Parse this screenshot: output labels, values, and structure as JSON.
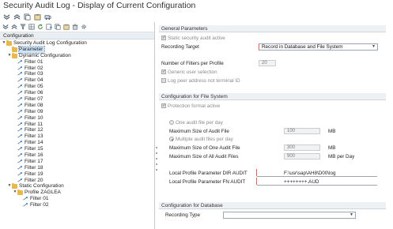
{
  "window": {
    "title": "Security Audit Log - Display of Current Configuration"
  },
  "toolbar_icons": [
    "expand-all-icon",
    "collapse-all-icon",
    "copy-icon",
    "paste-icon",
    "transport-icon"
  ],
  "tree_toolbar_icons": [
    "expand-all-icon",
    "collapse-all-icon",
    "filter-icon",
    "table-icon",
    "refresh-icon",
    "add-icon",
    "copy-icon",
    "paste-icon",
    "delete-icon",
    "settings-icon"
  ],
  "tree": {
    "header": "Configuration",
    "root": "Security Audit Log Configuration",
    "parameter": "Parameter",
    "dynamic": "Dynamic Configuration",
    "dynamic_filters": [
      "Filter 01",
      "Filter 02",
      "Filter 03",
      "Filter 04",
      "Filter 05",
      "Filter 06",
      "Filter 07",
      "Filter 08",
      "Filter 09",
      "Filter 10",
      "Filter 11",
      "Filter 12",
      "Filter 13",
      "Filter 14",
      "Filter 15",
      "Filter 16",
      "Filter 17",
      "Filter 18",
      "Filter 19",
      "Filter 20"
    ],
    "static": "Static Configuration",
    "profile": "Profile ZAGLEA",
    "profile_filters": [
      "Filter 01",
      "Filter 02"
    ]
  },
  "general": {
    "header": "General Parameters",
    "static_active": "Static security audit active",
    "recording_target_label": "Recording Target",
    "recording_target_value": "Record in Database and File System",
    "num_filters_label": "Number of Filters per Profile",
    "num_filters_value": "20",
    "generic_user": "Generic user selection",
    "log_peer": "Log peer address not terminal ID"
  },
  "file_system": {
    "header": "Configuration for File System",
    "protection": "Protection format active",
    "one_file": "One audit file per day",
    "max_size_label": "Maximum Size of Audit File",
    "max_size_value": "100",
    "max_size_unit": "MB",
    "multiple_files": "Multiple audit files per day",
    "max_one_label": "Maximum Size of One Audit File",
    "max_one_value": "300",
    "max_one_unit": "MB",
    "max_all_label": "Maximum Size of All Audit Files",
    "max_all_value": "900",
    "max_all_unit": "MB per Day",
    "dir_label": "Local Profile Parameter DIR AUDIT",
    "dir_value": "F:\\usr\\sap\\AH8\\D00\\log",
    "fn_label": "Local Profile Parameter FN AUDIT",
    "fn_value": "++++++++.AUD"
  },
  "database": {
    "header": "Configuration for Database",
    "recording_type_label": "Recording Type",
    "recording_type_value": ""
  }
}
